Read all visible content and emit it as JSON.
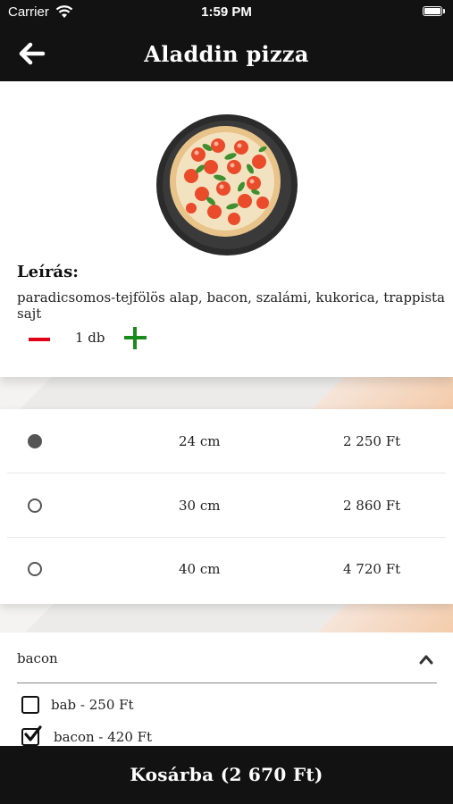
{
  "status_bar": {
    "carrier": "Carrier",
    "time": "1:59 PM"
  },
  "header": {
    "title": "Aladdin pizza",
    "back_icon": "arrow-left-icon"
  },
  "product": {
    "image": "pizza-image",
    "description_title": "Leírás:",
    "description": "paradicsomos-tejfölös alap, bacon, szalámi, kukorica, trappista sajt",
    "quantity": "1 db"
  },
  "sizes": [
    {
      "size": "24 cm",
      "price": "2 250 Ft",
      "selected": true
    },
    {
      "size": "30 cm",
      "price": "2 860 Ft",
      "selected": false
    },
    {
      "size": "40 cm",
      "price": "4 720 Ft",
      "selected": false
    }
  ],
  "extras": {
    "group_label": "bacon",
    "expanded_icon": "chevron-up-icon",
    "options": [
      {
        "label": "bab - 250 Ft",
        "checked": false
      },
      {
        "label": "bacon - 420 Ft",
        "checked": true
      }
    ]
  },
  "cart": {
    "label": "Kosárba (2 670 Ft)"
  },
  "colors": {
    "bar": "#121212",
    "minus": "#e3001b",
    "plus": "#1a8a1a",
    "accent_stripe": "#f3c9a6"
  }
}
